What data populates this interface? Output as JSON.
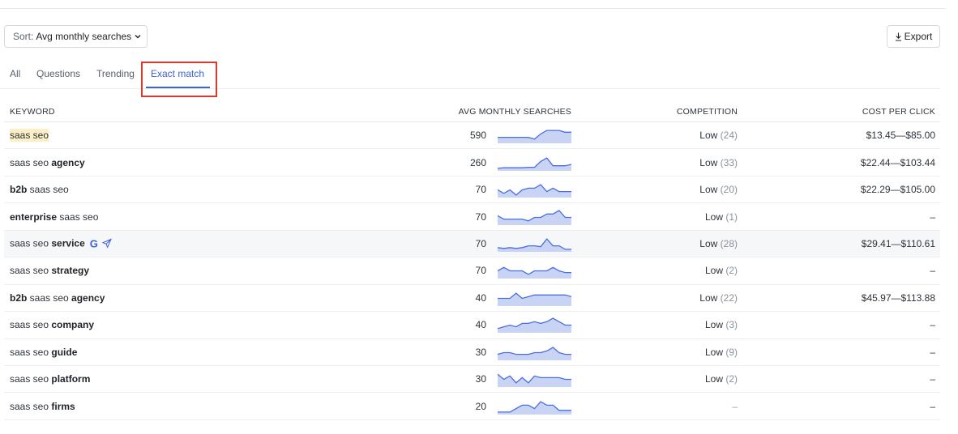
{
  "toolbar": {
    "sort_prefix": "Sort:",
    "sort_value": "Avg monthly searches",
    "export_label": "Export"
  },
  "tabs": [
    {
      "label": "All",
      "active": false
    },
    {
      "label": "Questions",
      "active": false
    },
    {
      "label": "Trending",
      "active": false
    },
    {
      "label": "Exact match",
      "active": true
    }
  ],
  "columns": {
    "keyword": "KEYWORD",
    "avg": "AVG MONTHLY SEARCHES",
    "competition": "COMPETITION",
    "cpc": "COST PER CLICK"
  },
  "colors": {
    "accent": "#3b63d9",
    "spark_line": "#4a6fe0",
    "spark_fill": "#c9d3f4",
    "highlight": "#fcefc6",
    "callout": "#e0382a"
  },
  "rows": [
    {
      "parts": [
        {
          "t": "saas seo",
          "b": false,
          "hl": true
        }
      ],
      "volume": "590",
      "comp_level": "Low",
      "comp_num": "(24)",
      "cpc": "$13.45—$85.00",
      "spark": [
        3,
        3,
        3,
        3,
        3,
        3,
        2,
        5,
        7,
        7,
        7,
        6,
        6
      ]
    },
    {
      "parts": [
        {
          "t": "saas seo ",
          "b": false
        },
        {
          "t": "agency",
          "b": true
        }
      ],
      "volume": "260",
      "comp_level": "Low",
      "comp_num": "(33)",
      "cpc": "$22.44—$103.44",
      "spark": [
        1,
        1.3,
        1.3,
        1.3,
        1.3,
        1.6,
        1.6,
        5,
        7,
        2.5,
        2.5,
        2.5,
        3.3
      ]
    },
    {
      "parts": [
        {
          "t": "b2b",
          "b": true
        },
        {
          "t": " saas seo",
          "b": false
        }
      ],
      "volume": "70",
      "comp_level": "Low",
      "comp_num": "(20)",
      "cpc": "$22.29—$105.00",
      "spark": [
        4,
        2,
        4,
        1,
        4,
        5,
        5,
        7,
        3,
        5,
        3,
        3,
        3
      ]
    },
    {
      "parts": [
        {
          "t": "enterprise",
          "b": true
        },
        {
          "t": " saas seo",
          "b": false
        }
      ],
      "volume": "70",
      "comp_level": "Low",
      "comp_num": "(1)",
      "cpc": "–",
      "spark": [
        5,
        3,
        3,
        3,
        3,
        2,
        4,
        4,
        6,
        6,
        8,
        4,
        4
      ]
    },
    {
      "parts": [
        {
          "t": "saas seo ",
          "b": false
        },
        {
          "t": "service",
          "b": true
        }
      ],
      "icons": true,
      "volume": "70",
      "comp_level": "Low",
      "comp_num": "(28)",
      "cpc": "$29.41—$110.61",
      "spark": [
        2,
        1.5,
        2,
        1.5,
        2,
        3,
        3,
        2.5,
        7,
        3,
        3,
        1,
        1
      ]
    },
    {
      "parts": [
        {
          "t": "saas seo ",
          "b": false
        },
        {
          "t": "strategy",
          "b": true
        }
      ],
      "volume": "70",
      "comp_level": "Low",
      "comp_num": "(2)",
      "cpc": "–",
      "spark": [
        4,
        6,
        4,
        4,
        4,
        2,
        4,
        4,
        4,
        6,
        4,
        3,
        3
      ]
    },
    {
      "parts": [
        {
          "t": "b2b",
          "b": true
        },
        {
          "t": " saas seo ",
          "b": false
        },
        {
          "t": "agency",
          "b": true
        }
      ],
      "volume": "40",
      "comp_level": "Low",
      "comp_num": "(22)",
      "cpc": "$45.97—$113.88",
      "spark": [
        4,
        4,
        4,
        7,
        4,
        5,
        6,
        6,
        6,
        6,
        6,
        6,
        5
      ]
    },
    {
      "parts": [
        {
          "t": "saas seo ",
          "b": false
        },
        {
          "t": "company",
          "b": true
        }
      ],
      "volume": "40",
      "comp_level": "Low",
      "comp_num": "(3)",
      "cpc": "–",
      "spark": [
        2,
        3,
        4,
        3,
        5,
        5,
        6,
        5,
        6,
        8,
        6,
        4,
        4
      ]
    },
    {
      "parts": [
        {
          "t": "saas seo ",
          "b": false
        },
        {
          "t": "guide",
          "b": true
        }
      ],
      "volume": "30",
      "comp_level": "Low",
      "comp_num": "(9)",
      "cpc": "–",
      "spark": [
        3,
        4,
        4,
        3,
        3,
        3,
        4,
        4,
        5,
        7,
        4,
        3,
        3
      ]
    },
    {
      "parts": [
        {
          "t": "saas seo ",
          "b": false
        },
        {
          "t": "platform",
          "b": true
        }
      ],
      "volume": "30",
      "comp_level": "Low",
      "comp_num": "(2)",
      "cpc": "–",
      "spark": [
        7,
        4,
        6,
        2,
        5,
        2,
        6,
        5,
        5,
        5,
        5,
        4,
        4
      ]
    },
    {
      "parts": [
        {
          "t": "saas seo ",
          "b": false
        },
        {
          "t": "firms",
          "b": true
        }
      ],
      "volume": "20",
      "comp_level": "–",
      "comp_num": "",
      "cpc": "–",
      "spark": [
        1,
        1,
        1,
        3,
        5,
        5,
        3,
        7,
        5,
        5,
        2,
        2,
        2
      ]
    }
  ]
}
